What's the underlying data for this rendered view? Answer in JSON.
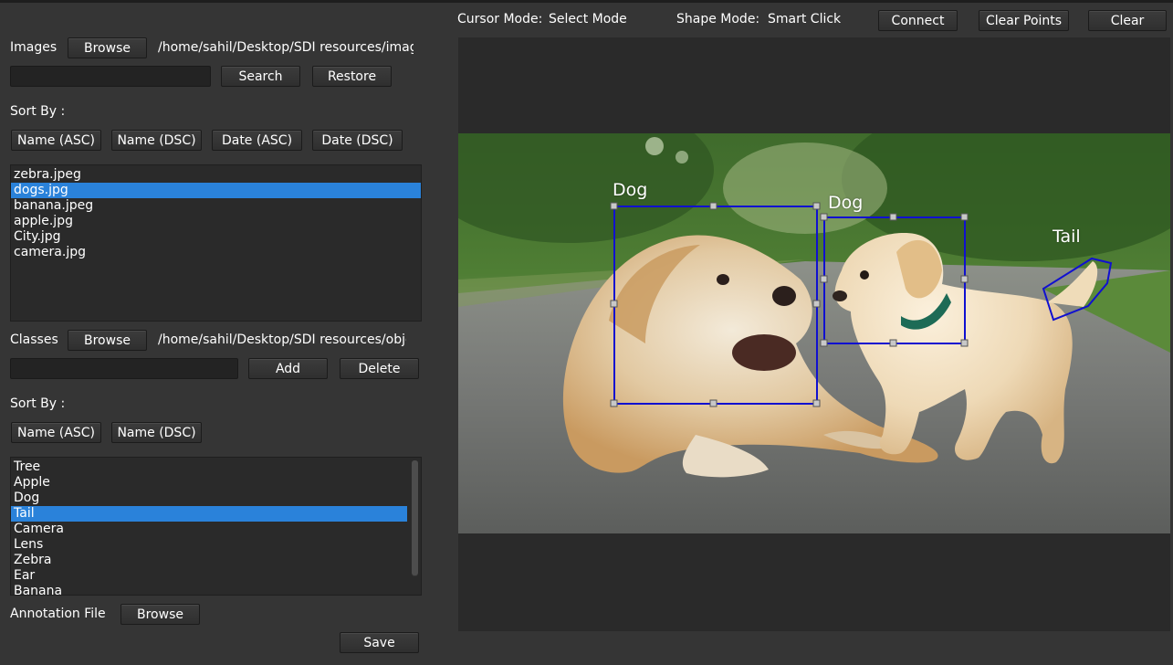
{
  "toolbar": {
    "cursor_mode_label": "Cursor Mode:",
    "cursor_mode_value": "Select Mode",
    "shape_mode_label": "Shape Mode:",
    "shape_mode_value": "Smart Click",
    "connect_label": "Connect",
    "clear_points_label": "Clear Points",
    "clear_label": "Clear"
  },
  "images": {
    "label": "Images",
    "browse_label": "Browse",
    "path": "/home/sahil/Desktop/SDI resources/images",
    "search_value": "",
    "search_label": "Search",
    "restore_label": "Restore",
    "sort_label": "Sort By :",
    "sort_buttons": [
      "Name (ASC)",
      "Name (DSC)",
      "Date (ASC)",
      "Date (DSC)"
    ],
    "files": [
      "zebra.jpeg",
      "dogs.jpg",
      "banana.jpeg",
      "apple.jpg",
      "City.jpg",
      "camera.jpg"
    ],
    "selected": "dogs.jpg"
  },
  "classes": {
    "label": "Classes",
    "browse_label": "Browse",
    "path": "/home/sahil/Desktop/SDI resources/objects",
    "input_value": "",
    "add_label": "Add",
    "delete_label": "Delete",
    "sort_label": "Sort By :",
    "sort_buttons": [
      "Name (ASC)",
      "Name (DSC)"
    ],
    "items": [
      "Tree",
      "Apple",
      "Dog",
      "Tail",
      "Camera",
      "Lens",
      "Zebra",
      "Ear",
      "Banana"
    ],
    "selected": "Tail"
  },
  "annotation": {
    "label": "Annotation File",
    "browse_label": "Browse",
    "save_label": "Save"
  },
  "annotations": [
    {
      "label": "Dog",
      "shape": "rectangle"
    },
    {
      "label": "Dog",
      "shape": "rectangle"
    },
    {
      "label": "Tail",
      "shape": "polygon"
    }
  ],
  "colors": {
    "background": "#353535",
    "selection": "#2a82da",
    "annotation_stroke": "#1010d0",
    "handle": "#c8c8c8"
  }
}
